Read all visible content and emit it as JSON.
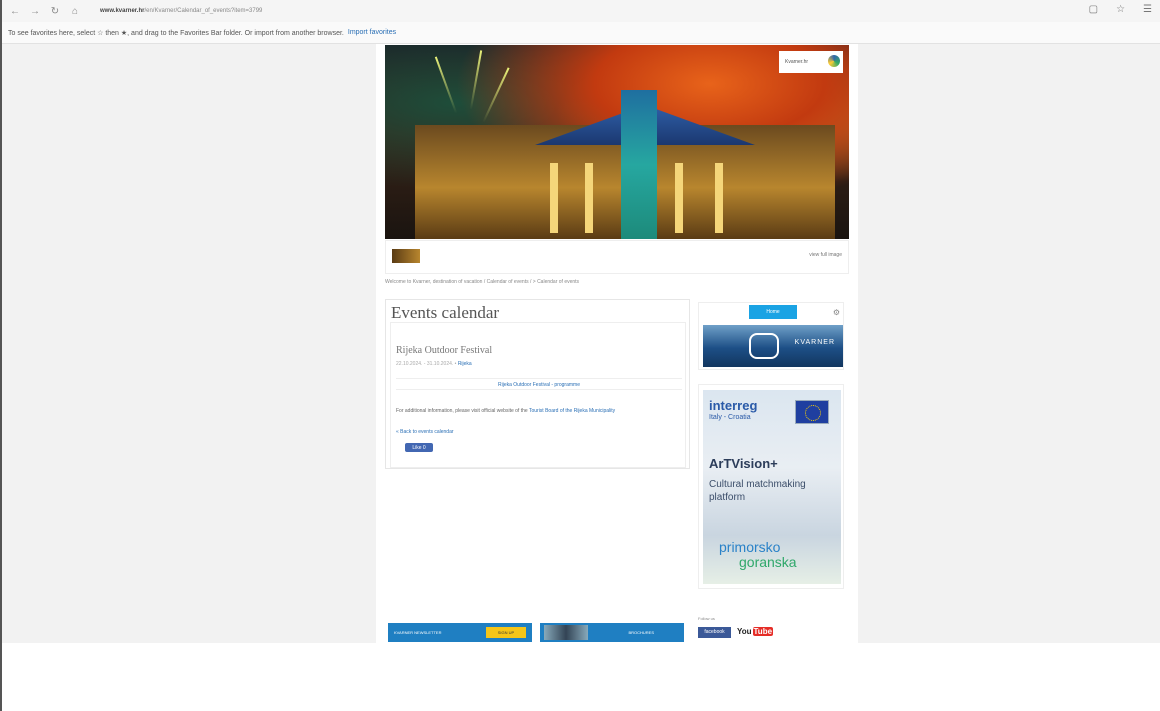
{
  "browser": {
    "url_domain": "www.kvarner.hr",
    "url_path": "/en/Kvarner/Calendar_of_events?item=3799",
    "favorites_text": "To see favorites here, select ☆ then ★, and drag to the Favorites Bar folder. Or import from another browser.",
    "import_link": "Import favorites"
  },
  "hero": {
    "badge_text": "Kvarner.hr",
    "large_image_link": "view full image"
  },
  "breadcrumb": "Welcome to Kvarner, destination of vacation / Calendar of events / > Calendar of events",
  "events": {
    "heading": "Events calendar",
    "event_title": "Rijeka Outdoor Festival",
    "event_date": "22.10.2024. - 31.10.2024.",
    "event_place": "Rijeka",
    "program_link": "Rijeka Outdoor Festival - programme",
    "info_text": "For additional information, please visit official website of the",
    "info_link": "Tourist Board of the Rijeka Municipality",
    "back_link": "« Back to events calendar",
    "like_label": "Like 0"
  },
  "sidebar": {
    "button_label": "Home",
    "kvarner_logo": "KVARNER",
    "ad": {
      "brand": "interreg",
      "sub": "Italy - Croatia",
      "title": "ArTVision+",
      "subtitle_line1": "Cultural matchmaking",
      "subtitle_line2": "platform",
      "region_line1": "primorsko",
      "region_line2": "goranska"
    }
  },
  "footer": {
    "newsletter_label": "KVARNER NEWSLETTER",
    "newsletter_button": "SIGN UP",
    "download_label": "BROCHURES",
    "follow_label": "Follow us",
    "facebook_label": "facebook",
    "youtube_label": "You",
    "youtube_tube": "Tube"
  }
}
